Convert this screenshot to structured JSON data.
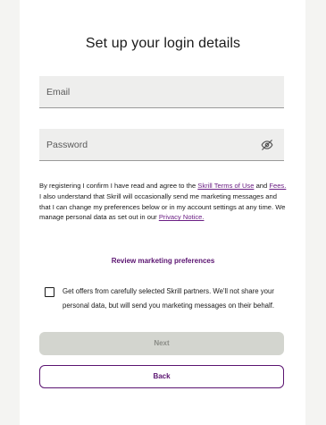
{
  "page": {
    "title": "Set up your login details"
  },
  "form": {
    "email": {
      "placeholder": "Email",
      "value": ""
    },
    "password": {
      "placeholder": "Password",
      "value": "",
      "visibility_icon": "eye-slash-icon"
    }
  },
  "legal": {
    "text_1": "By registering I confirm I have read and agree to the ",
    "terms_link": "Skrill Terms of Use",
    "text_2": " and ",
    "fees_link": "Fees.",
    "text_3": " I also understand that Skrill will occasionally send me marketing messages and that I can change my preferences below or in my account settings at any time. We manage personal data as set out in our ",
    "privacy_link": "Privacy Notice."
  },
  "marketing": {
    "review_link": "Review marketing preferences",
    "partner_offers_label": "Get offers from carefully selected Skrill partners. We'll not share your personal data, but will send you marketing messages on their behalf.",
    "partner_offers_checked": false
  },
  "actions": {
    "next_label": "Next",
    "back_label": "Back"
  },
  "colors": {
    "brand_purple": "#5b1471",
    "link_purple": "#6b1f84",
    "disabled_button": "#d3d5cf",
    "field_background": "#eeeeed",
    "page_background": "#f4f4f2"
  }
}
